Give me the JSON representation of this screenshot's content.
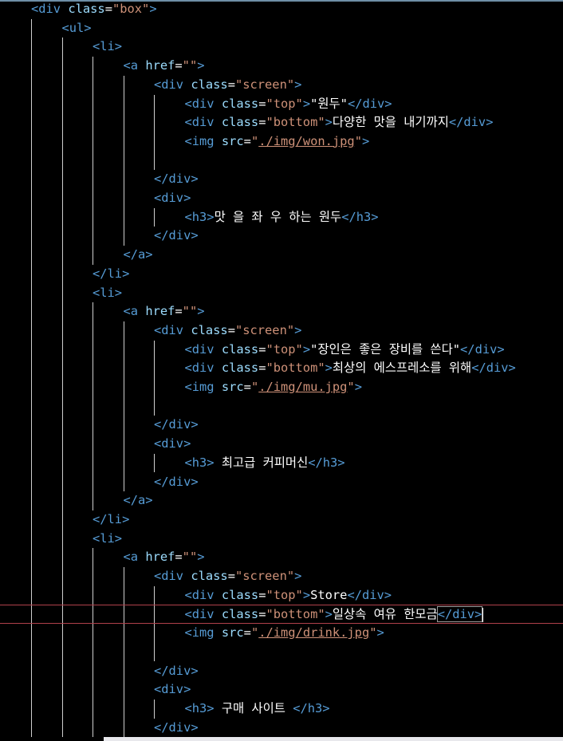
{
  "editor": {
    "language": "html",
    "theme_colors": {
      "tag": "#569cd6",
      "attr": "#9cdcfe",
      "string": "#ce9178",
      "text": "#ffffff",
      "current_line_border": "#b0414b"
    },
    "lines": [
      [
        {
          "t": "tag",
          "s": "<div "
        },
        {
          "t": "attr",
          "s": "class"
        },
        {
          "t": "txt",
          "s": "="
        },
        {
          "t": "str",
          "s": "\"box\""
        },
        {
          "t": "tag",
          "s": ">"
        }
      ],
      [
        {
          "t": "tag",
          "s": "<ul>"
        }
      ],
      [
        {
          "t": "tag",
          "s": "<li>"
        }
      ],
      [
        {
          "t": "tag",
          "s": "<a "
        },
        {
          "t": "attr",
          "s": "href"
        },
        {
          "t": "txt",
          "s": "="
        },
        {
          "t": "str",
          "s": "\"\""
        },
        {
          "t": "tag",
          "s": ">"
        }
      ],
      [
        {
          "t": "tag",
          "s": "<div "
        },
        {
          "t": "attr",
          "s": "class"
        },
        {
          "t": "txt",
          "s": "="
        },
        {
          "t": "str",
          "s": "\"screen\""
        },
        {
          "t": "tag",
          "s": ">"
        }
      ],
      [
        {
          "t": "tag",
          "s": "<div "
        },
        {
          "t": "attr",
          "s": "class"
        },
        {
          "t": "txt",
          "s": "="
        },
        {
          "t": "str",
          "s": "\"top\""
        },
        {
          "t": "tag",
          "s": ">"
        },
        {
          "t": "txt",
          "s": "\"원두\""
        },
        {
          "t": "tag",
          "s": "</div>"
        }
      ],
      [
        {
          "t": "tag",
          "s": "<div "
        },
        {
          "t": "attr",
          "s": "class"
        },
        {
          "t": "txt",
          "s": "="
        },
        {
          "t": "str",
          "s": "\"bottom\""
        },
        {
          "t": "tag",
          "s": ">"
        },
        {
          "t": "txt",
          "s": "다양한 맛을 내기까지"
        },
        {
          "t": "tag",
          "s": "</div>"
        }
      ],
      [
        {
          "t": "tag",
          "s": "<img "
        },
        {
          "t": "attr",
          "s": "src"
        },
        {
          "t": "txt",
          "s": "="
        },
        {
          "t": "str",
          "s": "\""
        },
        {
          "t": "link",
          "s": "./img/won.jpg"
        },
        {
          "t": "str",
          "s": "\""
        },
        {
          "t": "tag",
          "s": ">"
        }
      ],
      [],
      [
        {
          "t": "tag",
          "s": "</div>"
        }
      ],
      [
        {
          "t": "tag",
          "s": "<div>"
        }
      ],
      [
        {
          "t": "tag",
          "s": "<h3>"
        },
        {
          "t": "txt",
          "s": "맛 을 좌 우 하는 원두"
        },
        {
          "t": "tag",
          "s": "</h3>"
        }
      ],
      [
        {
          "t": "tag",
          "s": "</div>"
        }
      ],
      [
        {
          "t": "tag",
          "s": "</a>"
        }
      ],
      [
        {
          "t": "tag",
          "s": "</li>"
        }
      ],
      [
        {
          "t": "tag",
          "s": "<li>"
        }
      ],
      [
        {
          "t": "tag",
          "s": "<a "
        },
        {
          "t": "attr",
          "s": "href"
        },
        {
          "t": "txt",
          "s": "="
        },
        {
          "t": "str",
          "s": "\"\""
        },
        {
          "t": "tag",
          "s": ">"
        }
      ],
      [
        {
          "t": "tag",
          "s": "<div "
        },
        {
          "t": "attr",
          "s": "class"
        },
        {
          "t": "txt",
          "s": "="
        },
        {
          "t": "str",
          "s": "\"screen\""
        },
        {
          "t": "tag",
          "s": ">"
        }
      ],
      [
        {
          "t": "tag",
          "s": "<div "
        },
        {
          "t": "attr",
          "s": "class"
        },
        {
          "t": "txt",
          "s": "="
        },
        {
          "t": "str",
          "s": "\"top\""
        },
        {
          "t": "tag",
          "s": ">"
        },
        {
          "t": "txt",
          "s": "\"장인은 좋은 장비를 쓴다\""
        },
        {
          "t": "tag",
          "s": "</div>"
        }
      ],
      [
        {
          "t": "tag",
          "s": "<div "
        },
        {
          "t": "attr",
          "s": "class"
        },
        {
          "t": "txt",
          "s": "="
        },
        {
          "t": "str",
          "s": "\"bottom\""
        },
        {
          "t": "tag",
          "s": ">"
        },
        {
          "t": "txt",
          "s": "최상의 에스프레소를 위해"
        },
        {
          "t": "tag",
          "s": "</div>"
        }
      ],
      [
        {
          "t": "tag",
          "s": "<img "
        },
        {
          "t": "attr",
          "s": "src"
        },
        {
          "t": "txt",
          "s": "="
        },
        {
          "t": "str",
          "s": "\""
        },
        {
          "t": "link",
          "s": "./img/mu.jpg"
        },
        {
          "t": "str",
          "s": "\""
        },
        {
          "t": "tag",
          "s": ">"
        }
      ],
      [],
      [
        {
          "t": "tag",
          "s": "</div>"
        }
      ],
      [
        {
          "t": "tag",
          "s": "<div>"
        }
      ],
      [
        {
          "t": "tag",
          "s": "<h3>"
        },
        {
          "t": "txt",
          "s": " 최고급 커피머신"
        },
        {
          "t": "tag",
          "s": "</h3>"
        }
      ],
      [
        {
          "t": "tag",
          "s": "</div>"
        }
      ],
      [
        {
          "t": "tag",
          "s": "</a>"
        }
      ],
      [
        {
          "t": "tag",
          "s": "</li>"
        }
      ],
      [
        {
          "t": "tag",
          "s": "<li>"
        }
      ],
      [
        {
          "t": "tag",
          "s": "<a "
        },
        {
          "t": "attr",
          "s": "href"
        },
        {
          "t": "txt",
          "s": "="
        },
        {
          "t": "str",
          "s": "\"\""
        },
        {
          "t": "tag",
          "s": ">"
        }
      ],
      [
        {
          "t": "tag",
          "s": "<div "
        },
        {
          "t": "attr",
          "s": "class"
        },
        {
          "t": "txt",
          "s": "="
        },
        {
          "t": "str",
          "s": "\"screen\""
        },
        {
          "t": "tag",
          "s": ">"
        }
      ],
      [
        {
          "t": "tag",
          "s": "<div "
        },
        {
          "t": "attr",
          "s": "class"
        },
        {
          "t": "txt",
          "s": "="
        },
        {
          "t": "str",
          "s": "\"top\""
        },
        {
          "t": "tag",
          "s": ">"
        },
        {
          "t": "txt",
          "s": "Store"
        },
        {
          "t": "tag",
          "s": "</div>"
        }
      ],
      [
        {
          "t": "tag",
          "s": "<div "
        },
        {
          "t": "attr",
          "s": "class"
        },
        {
          "t": "txt",
          "s": "="
        },
        {
          "t": "str",
          "s": "\"bottom\""
        },
        {
          "t": "tag",
          "s": ">"
        },
        {
          "t": "txt",
          "s": "일상속 여유 한모금"
        },
        {
          "t": "tag",
          "s": "</div>"
        }
      ],
      [
        {
          "t": "tag",
          "s": "<img "
        },
        {
          "t": "attr",
          "s": "src"
        },
        {
          "t": "txt",
          "s": "="
        },
        {
          "t": "str",
          "s": "\""
        },
        {
          "t": "link",
          "s": "./img/drink.jpg"
        },
        {
          "t": "str",
          "s": "\""
        },
        {
          "t": "tag",
          "s": ">"
        }
      ],
      [],
      [
        {
          "t": "tag",
          "s": "</div>"
        }
      ],
      [
        {
          "t": "tag",
          "s": "<div>"
        }
      ],
      [
        {
          "t": "tag",
          "s": "<h3>"
        },
        {
          "t": "txt",
          "s": " 구매 사이트 "
        },
        {
          "t": "tag",
          "s": "</h3>"
        }
      ],
      [
        {
          "t": "tag",
          "s": "</div>"
        }
      ]
    ]
  }
}
